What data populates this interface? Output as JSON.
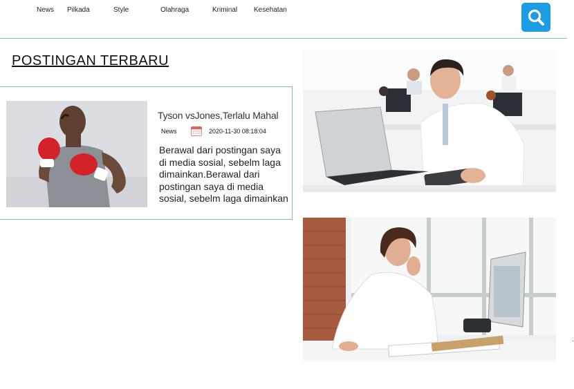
{
  "nav": {
    "items": [
      "News",
      "Pilkada",
      "Style",
      "Olahraga",
      "Kriminal",
      "Kesehatan"
    ]
  },
  "search": {
    "icon": "search-icon",
    "color": "#1d9ce3"
  },
  "section": {
    "title": "POSTINGAN TERBARU"
  },
  "post": {
    "title": "Tyson vsJones,Terlalu Mahal",
    "category": "News",
    "date": "2020-11-30 08:18:04",
    "excerpt": "Berawal dari postingan saya di media sosial, sebelm laga dimainkan.Berawal dari postingan saya di media sosial, sebelm laga dimainkan"
  },
  "side_images": [
    "office-worker-laptop-photo",
    "woman-phone-call-photo"
  ],
  "colors": {
    "accent": "#1d9ce3",
    "border": "#7fb6d6"
  }
}
